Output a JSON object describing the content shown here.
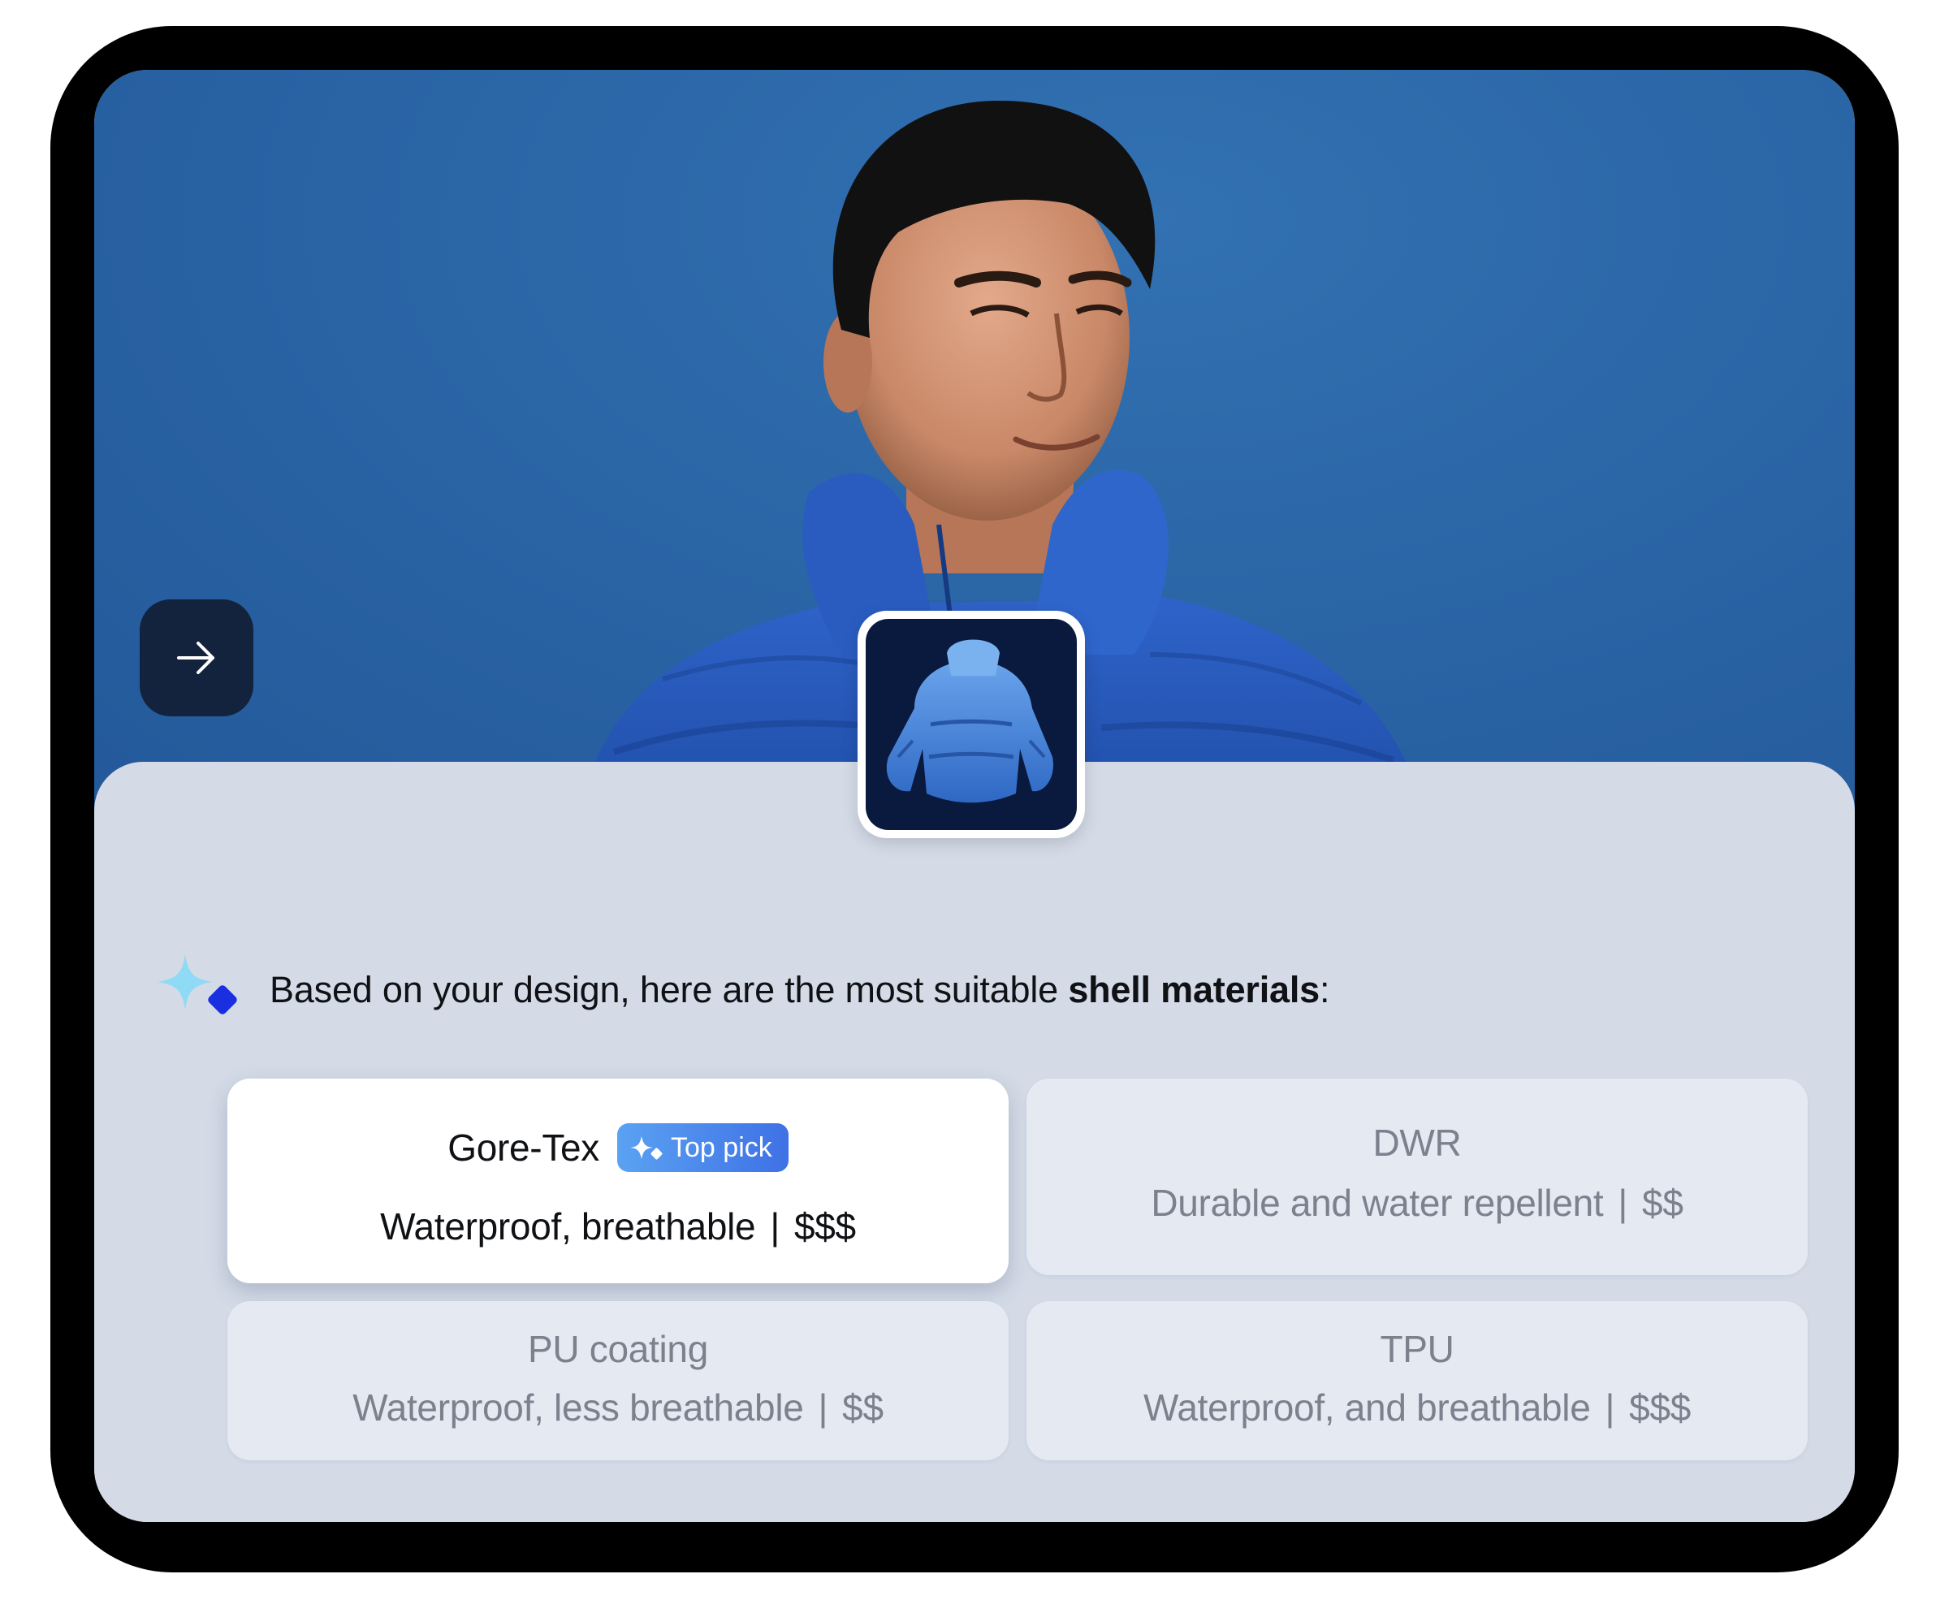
{
  "hero": {
    "nav_arrow_icon": "arrow-right-icon"
  },
  "prompt": {
    "icon": "sparkle-ai-icon",
    "text_before": "Based on your design, here are the most suitable ",
    "text_bold": "shell materials",
    "text_after": ":"
  },
  "options": [
    {
      "name": "Gore-Tex",
      "badge": "Top pick",
      "badge_icon": "sparkle-icon",
      "description": "Waterproof, breathable",
      "separator": "|",
      "price": "$$$",
      "selected": true
    },
    {
      "name": "DWR",
      "description": "Durable and water repellent",
      "separator": "|",
      "price": "$$",
      "selected": false
    },
    {
      "name": "PU coating",
      "description": "Waterproof, less breathable",
      "separator": "|",
      "price": "$$",
      "selected": false
    },
    {
      "name": "TPU",
      "description": "Waterproof, and breathable",
      "separator": "|",
      "price": "$$$",
      "selected": false
    }
  ],
  "colors": {
    "hero_background": "#2b66a7",
    "panel_background": "#d4dbe7",
    "badge_start": "#5aa2f2",
    "badge_end": "#3f71e6",
    "nav_button": "#13233d"
  }
}
